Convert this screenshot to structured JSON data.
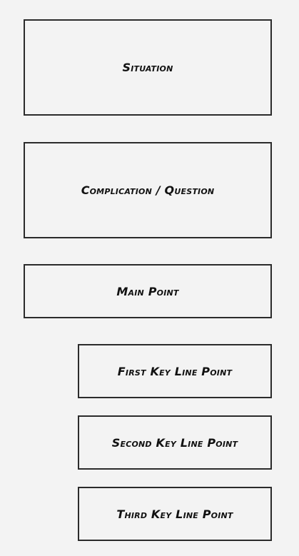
{
  "diagram": {
    "boxes": {
      "situation": "Situation",
      "complication": "Complication / Question",
      "main_point": "Main Point",
      "first_key_line_point": "First Key Line Point",
      "second_key_line_point": "Second Key Line Point",
      "third_key_line_point": "Third Key Line Point"
    }
  },
  "colors": {
    "background": "#f3f3f3",
    "border": "#2b2b2b",
    "text": "#111111"
  }
}
